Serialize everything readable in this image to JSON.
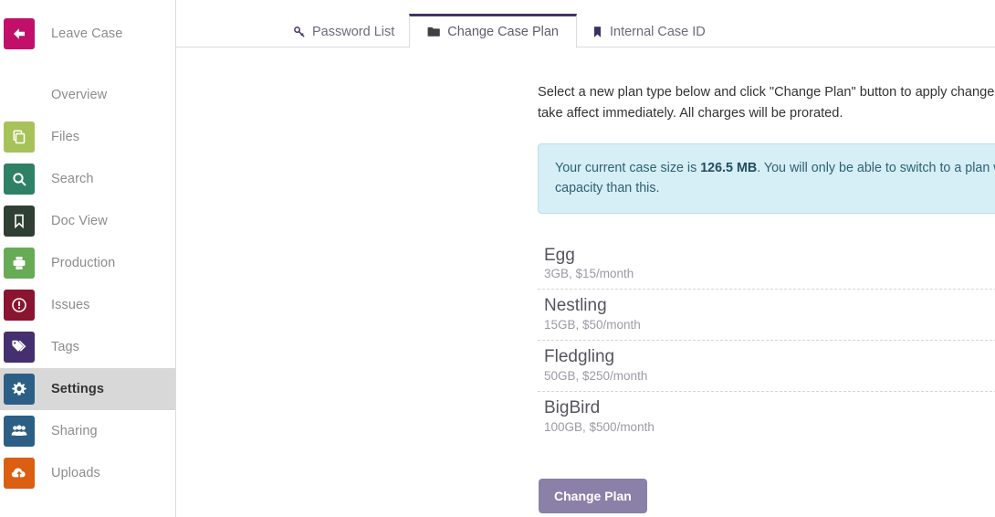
{
  "sidebar": {
    "items": [
      {
        "label": "Leave Case",
        "icon": "arrow-left-icon",
        "color": "#c2106a",
        "active": false,
        "group": "top"
      },
      {
        "label": "Overview",
        "icon": "eye-icon",
        "color": "#f0b busy",
        "active": false,
        "group": "main"
      },
      {
        "label": "Files",
        "icon": "files-icon",
        "color": "#a8c25a",
        "active": false,
        "group": "main"
      },
      {
        "label": "Search",
        "icon": "magnifier-icon",
        "color": "#2e8165",
        "active": false,
        "group": "main"
      },
      {
        "label": "Doc View",
        "icon": "bookmark-icon",
        "color": "#2f3f34",
        "active": false,
        "group": "main"
      },
      {
        "label": "Production",
        "icon": "printer-icon",
        "color": "#67ab55",
        "active": false,
        "group": "main"
      },
      {
        "label": "Issues",
        "icon": "alert-circle-icon",
        "color": "#8b1430",
        "active": false,
        "group": "main"
      },
      {
        "label": "Tags",
        "icon": "tag-icon",
        "color": "#44306e",
        "active": false,
        "group": "main"
      },
      {
        "label": "Settings",
        "icon": "gear-icon",
        "color": "#2b5f86",
        "active": true,
        "group": "main"
      },
      {
        "label": "Sharing",
        "icon": "users-icon",
        "color": "#2b5f86",
        "active": false,
        "group": "main"
      },
      {
        "label": "Uploads",
        "icon": "cloud-upload-icon",
        "color": "#db5e11",
        "active": false,
        "group": "main"
      }
    ]
  },
  "tabs": [
    {
      "label": "Password List",
      "icon": "key-icon",
      "active": false
    },
    {
      "label": "Change Case Plan",
      "icon": "folder-icon",
      "active": true
    },
    {
      "label": "Internal Case ID",
      "icon": "bookmark-icon",
      "active": false
    }
  ],
  "main": {
    "intro": "Select a new plan type below and click \"Change Plan\" button to apply changes. Plan changes will take affect immediately. All charges will be prorated.",
    "alert": {
      "prefix": "Your current case size is ",
      "size": "126.5 MB",
      "suffix": ". You will only be able to switch to a plan which offers higher capacity than this."
    },
    "plans": [
      {
        "name": "Egg",
        "meta": "3GB, $15/month"
      },
      {
        "name": "Nestling",
        "meta": "15GB, $50/month"
      },
      {
        "name": "Fledgling",
        "meta": "50GB, $250/month"
      },
      {
        "name": "BigBird",
        "meta": "100GB, $500/month"
      }
    ],
    "change_plan_button": "Change Plan"
  },
  "colors": {
    "active_tab_border": "#443266",
    "button": "#8b80a8",
    "alert_bg": "#d6eef6",
    "sidebar_active_bg": "#d8d8d8"
  }
}
